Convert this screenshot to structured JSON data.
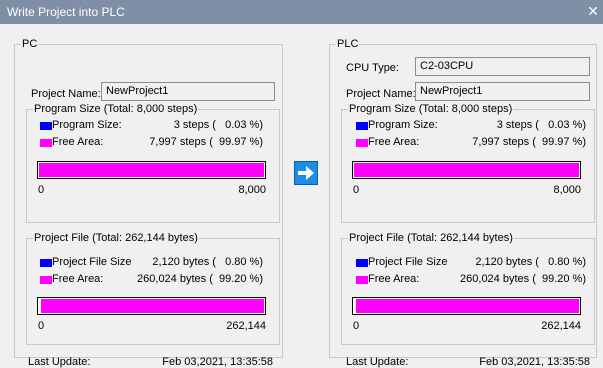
{
  "window": {
    "title": "Write Project into PLC",
    "close_glyph": "✕"
  },
  "colors": {
    "program_size": "#0000ff",
    "free_area": "#ff00ff"
  },
  "pc": {
    "legend": "PC",
    "project_name_label": "Project Name:",
    "project_name": "NewProject1",
    "program": {
      "legend": "Program Size (Total: 8,000 steps)",
      "size_label": "Program Size:",
      "size_value": "3 steps (   0.03 %)",
      "free_label": "Free Area:",
      "free_value": "7,997 steps (  99.97 %)",
      "used_fraction": 0.0003,
      "scale_min": "0",
      "scale_max": "8,000"
    },
    "file": {
      "legend": "Project File (Total: 262,144 bytes)",
      "size_label": "Project File Size",
      "size_value": "2,120 bytes (   0.80 %)",
      "free_label": "Free Area:",
      "free_value": "260,024 bytes (  99.20 %)",
      "used_fraction": 0.008,
      "scale_min": "0",
      "scale_max": "262,144"
    },
    "last_update_label": "Last Update:",
    "last_update": "Feb 03,2021, 13:35:58"
  },
  "transfer_button": {
    "icon": "arrow-right-icon"
  },
  "plc": {
    "legend": "PLC",
    "cpu_type_label": "CPU Type:",
    "cpu_type": "C2-03CPU",
    "project_name_label": "Project Name:",
    "project_name": "NewProject1",
    "program": {
      "legend": "Program Size (Total: 8,000 steps)",
      "size_label": "Program Size:",
      "size_value": "3 steps (   0.03 %)",
      "free_label": "Free Area:",
      "free_value": "7,997 steps (  99.97 %)",
      "used_fraction": 0.0003,
      "scale_min": "0",
      "scale_max": "8,000"
    },
    "file": {
      "legend": "Project File (Total: 262,144 bytes)",
      "size_label": "Project File Size",
      "size_value": "2,120 bytes (   0.80 %)",
      "free_label": "Free Area:",
      "free_value": "260,024 bytes (  99.20 %)",
      "used_fraction": 0.008,
      "scale_min": "0",
      "scale_max": "262,144"
    },
    "last_update_label": "Last Update:",
    "last_update": "Feb 03,2021, 13:35:58"
  }
}
